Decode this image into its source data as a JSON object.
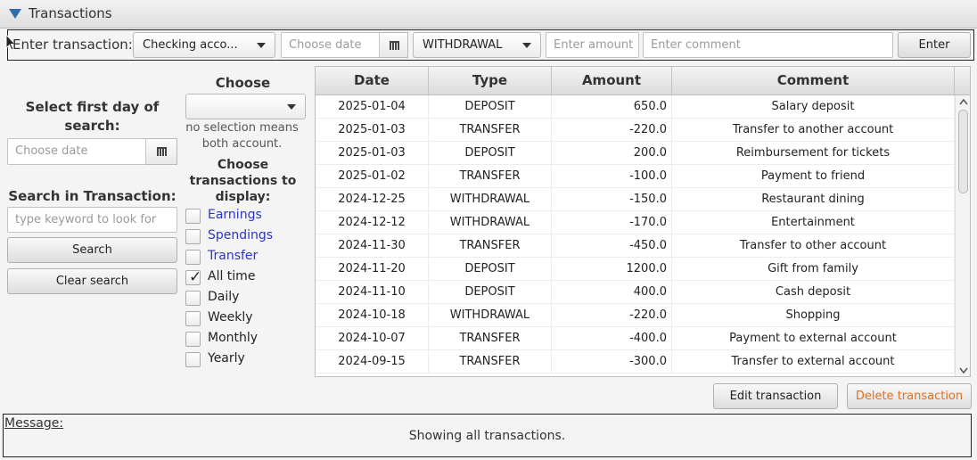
{
  "window": {
    "title": "Transactions"
  },
  "entry": {
    "label": "Enter transaction:",
    "account_value": "Checking acco...",
    "date_placeholder": "Choose date",
    "type_value": "WITHDRAWAL",
    "amount_placeholder": "Enter amount",
    "comment_placeholder": "Enter comment",
    "enter_label": "Enter"
  },
  "search": {
    "first_day_heading": "Select first day of search:",
    "date_placeholder": "Choose date",
    "search_heading": "Search in Transaction:",
    "keyword_placeholder": "type keyword to look for",
    "search_label": "Search",
    "clear_label": "Clear search"
  },
  "filter": {
    "account_heading": "Choose account:",
    "account_value": "",
    "account_hint": "no selection means both account.",
    "display_heading": "Choose transactions to display:",
    "options": [
      {
        "label": "Earnings",
        "checked": false,
        "link": true
      },
      {
        "label": "Spendings",
        "checked": false,
        "link": true
      },
      {
        "label": "Transfer",
        "checked": false,
        "link": true
      },
      {
        "label": "All time",
        "checked": true,
        "link": false
      },
      {
        "label": "Daily",
        "checked": false,
        "link": false
      },
      {
        "label": "Weekly",
        "checked": false,
        "link": false
      },
      {
        "label": "Monthly",
        "checked": false,
        "link": false
      },
      {
        "label": "Yearly",
        "checked": false,
        "link": false
      }
    ]
  },
  "table": {
    "columns": [
      "Date",
      "Type",
      "Amount",
      "Comment"
    ],
    "rows": [
      [
        "2025-01-04",
        "DEPOSIT",
        "650.0",
        "Salary deposit"
      ],
      [
        "2025-01-03",
        "TRANSFER",
        "-220.0",
        "Transfer to another account"
      ],
      [
        "2025-01-03",
        "DEPOSIT",
        "200.0",
        "Reimbursement for tickets"
      ],
      [
        "2025-01-02",
        "TRANSFER",
        "-100.0",
        "Payment to friend"
      ],
      [
        "2024-12-25",
        "WITHDRAWAL",
        "-150.0",
        "Restaurant dining"
      ],
      [
        "2024-12-12",
        "WITHDRAWAL",
        "-170.0",
        "Entertainment"
      ],
      [
        "2024-11-30",
        "TRANSFER",
        "-450.0",
        "Transfer to other account"
      ],
      [
        "2024-11-20",
        "DEPOSIT",
        "1200.0",
        "Gift from family"
      ],
      [
        "2024-11-10",
        "DEPOSIT",
        "400.0",
        "Cash deposit"
      ],
      [
        "2024-10-18",
        "WITHDRAWAL",
        "-220.0",
        "Shopping"
      ],
      [
        "2024-10-07",
        "TRANSFER",
        "-400.0",
        "Payment to external account"
      ],
      [
        "2024-09-15",
        "TRANSFER",
        "-300.0",
        "Transfer to external account"
      ]
    ]
  },
  "actions": {
    "edit_label": "Edit transaction",
    "delete_label": "Delete transaction"
  },
  "message": {
    "label": "Message:",
    "text": "Showing all transactions."
  },
  "colors": {
    "accent": "#2c6fa8",
    "link": "#2a35c5",
    "danger": "#e0701e"
  }
}
